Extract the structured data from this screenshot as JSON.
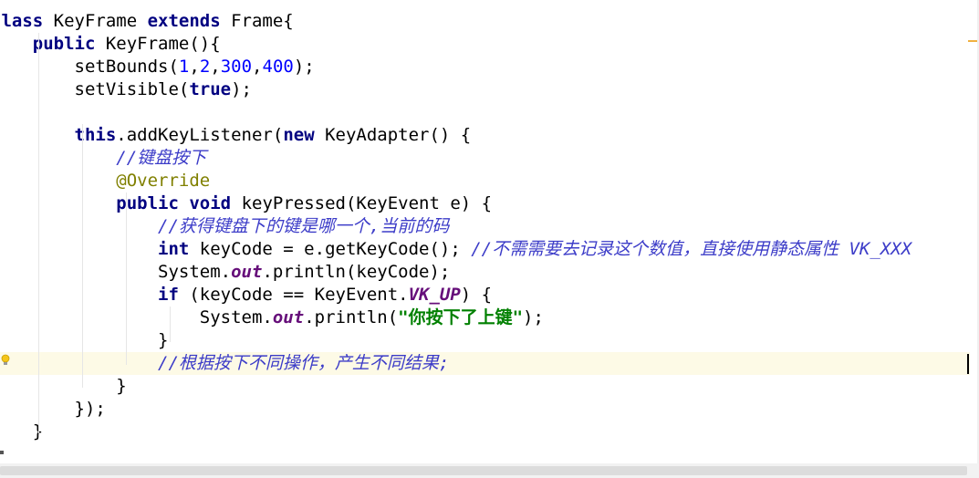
{
  "editor": {
    "lines": [
      [
        {
          "t": "class ",
          "c": "kw"
        },
        {
          "t": "KeyFrame ",
          "c": "plain"
        },
        {
          "t": "extends ",
          "c": "kw"
        },
        {
          "t": "Frame{",
          "c": "plain"
        }
      ],
      [
        {
          "t": "    ",
          "c": "plain"
        },
        {
          "t": "public ",
          "c": "kw"
        },
        {
          "t": "KeyFrame(){",
          "c": "plain"
        }
      ],
      [
        {
          "t": "        setBounds(",
          "c": "plain"
        },
        {
          "t": "1",
          "c": "num"
        },
        {
          "t": ",",
          "c": "plain"
        },
        {
          "t": "2",
          "c": "num"
        },
        {
          "t": ",",
          "c": "plain"
        },
        {
          "t": "300",
          "c": "num"
        },
        {
          "t": ",",
          "c": "plain"
        },
        {
          "t": "400",
          "c": "num"
        },
        {
          "t": ");",
          "c": "plain"
        }
      ],
      [
        {
          "t": "        setVisible(",
          "c": "plain"
        },
        {
          "t": "true",
          "c": "kw"
        },
        {
          "t": ");",
          "c": "plain"
        }
      ],
      [],
      [
        {
          "t": "        ",
          "c": "plain"
        },
        {
          "t": "this",
          "c": "kw"
        },
        {
          "t": ".addKeyListener(",
          "c": "plain"
        },
        {
          "t": "new ",
          "c": "kw"
        },
        {
          "t": "KeyAdapter() {",
          "c": "plain"
        }
      ],
      [
        {
          "t": "            ",
          "c": "plain"
        },
        {
          "t": "//键盘按下",
          "c": "cmt"
        }
      ],
      [
        {
          "t": "            ",
          "c": "plain"
        },
        {
          "t": "@Override",
          "c": "ann"
        }
      ],
      [
        {
          "t": "            ",
          "c": "plain"
        },
        {
          "t": "public ",
          "c": "kw"
        },
        {
          "t": "void ",
          "c": "kw"
        },
        {
          "t": "keyPressed(KeyEvent e) {",
          "c": "plain"
        }
      ],
      [
        {
          "t": "                ",
          "c": "plain"
        },
        {
          "t": "//获得键盘下的键是哪一个,当前的码",
          "c": "cmt"
        }
      ],
      [
        {
          "t": "                ",
          "c": "plain"
        },
        {
          "t": "int ",
          "c": "kw"
        },
        {
          "t": "keyCode = e.getKeyCode(); ",
          "c": "plain"
        },
        {
          "t": "//不需需要去记录这个数值，直接使用静态属性 VK_XXX",
          "c": "cmt"
        }
      ],
      [
        {
          "t": "                System.",
          "c": "plain"
        },
        {
          "t": "out",
          "c": "static"
        },
        {
          "t": ".println(keyCode);",
          "c": "plain"
        }
      ],
      [
        {
          "t": "                ",
          "c": "plain"
        },
        {
          "t": "if ",
          "c": "kw"
        },
        {
          "t": "(keyCode == KeyEvent.",
          "c": "plain"
        },
        {
          "t": "VK_UP",
          "c": "static"
        },
        {
          "t": ") {",
          "c": "plain"
        }
      ],
      [
        {
          "t": "                    System.",
          "c": "plain"
        },
        {
          "t": "out",
          "c": "static"
        },
        {
          "t": ".println(",
          "c": "plain"
        },
        {
          "t": "\"你按下了上键\"",
          "c": "str"
        },
        {
          "t": ");",
          "c": "plain"
        }
      ],
      [
        {
          "t": "                }",
          "c": "plain"
        }
      ],
      [
        {
          "t": "                ",
          "c": "plain"
        },
        {
          "t": "//根据按下不同操作，产生不同结果;",
          "c": "cmt"
        }
      ],
      [
        {
          "t": "            }",
          "c": "plain"
        }
      ],
      [
        {
          "t": "        });",
          "c": "plain"
        }
      ],
      [
        {
          "t": "    }",
          "c": "plain"
        }
      ]
    ],
    "current_line": 15,
    "colors": {
      "keyword": "#000080",
      "number": "#0000ff",
      "comment": "#3c3cc8",
      "annotation": "#808000",
      "string": "#008000",
      "static_field": "#660e7a",
      "current_line_bg": "#fdfae6"
    },
    "gutter_icon": "lightbulb-icon"
  }
}
